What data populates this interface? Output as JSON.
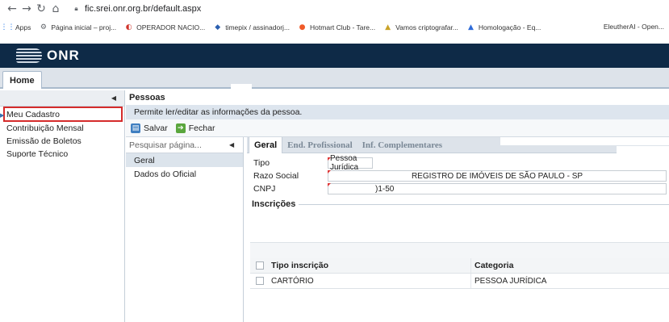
{
  "browser": {
    "url": "fic.srei.onr.org.br/default.aspx",
    "bookmarks": [
      {
        "label": "Apps",
        "icon": "apps-grid-icon",
        "glyph": "⋮⋮",
        "color": "#1a73e8"
      },
      {
        "label": "Página inicial – proj...",
        "icon": "globe-icon",
        "glyph": "⚙",
        "color": "#5f6368"
      },
      {
        "label": "OPERADOR NACIO...",
        "icon": "onr-logo-icon",
        "glyph": "◐",
        "color": "#d0342c"
      },
      {
        "label": "timepix / assinadorj...",
        "icon": "shield-icon",
        "glyph": "◆",
        "color": "#2b5fb0"
      },
      {
        "label": "Hotmart Club - Tare...",
        "icon": "flame-icon",
        "glyph": "●",
        "color": "#f05a28"
      },
      {
        "label": "Vamos criptografar...",
        "icon": "hat-icon",
        "glyph": "▲",
        "color": "#c9a227"
      },
      {
        "label": "Homologação - Eq...",
        "icon": "triangle-icon",
        "glyph": "▲",
        "color": "#2f6bd8"
      }
    ],
    "bookmark_last": "EleutherAI - Open..."
  },
  "app": {
    "logo_text": "ONR",
    "home_tab": "Home"
  },
  "sidebar": {
    "items": [
      {
        "label": "Meu Cadastro",
        "selected": true
      },
      {
        "label": "Contribuição Mensal",
        "selected": false
      },
      {
        "label": "Emissão de Boletos",
        "selected": false
      },
      {
        "label": "Suporte Técnico",
        "selected": false
      }
    ]
  },
  "panel": {
    "title": "Pessoas",
    "description": "Permite ler/editar as informações da pessoa.",
    "save_label": "Salvar",
    "close_label": "Fechar"
  },
  "pagenav": {
    "search_placeholder": "Pesquisar página...",
    "items": [
      {
        "label": "Geral",
        "selected": true
      },
      {
        "label": "Dados do Oficial",
        "selected": false
      }
    ]
  },
  "form": {
    "tabs": [
      "Geral",
      "End. Profissional",
      "Inf. Complementares"
    ],
    "fields": {
      "tipo_label": "Tipo",
      "tipo_value": "Pessoa Jurídica",
      "razao_label": "Razo Social",
      "razao_value": "REGISTRO DE IMÓVEIS DE SÃO PAULO - SP",
      "cnpj_label": "CNPJ",
      "cnpj_value": ")1-50"
    },
    "inscricoes_label": "Inscrições",
    "grid": {
      "headers": [
        "Tipo inscrição",
        "Categoria"
      ],
      "rows": [
        [
          "CARTÓRIO",
          "PESSOA JURÍDICA"
        ]
      ]
    }
  }
}
